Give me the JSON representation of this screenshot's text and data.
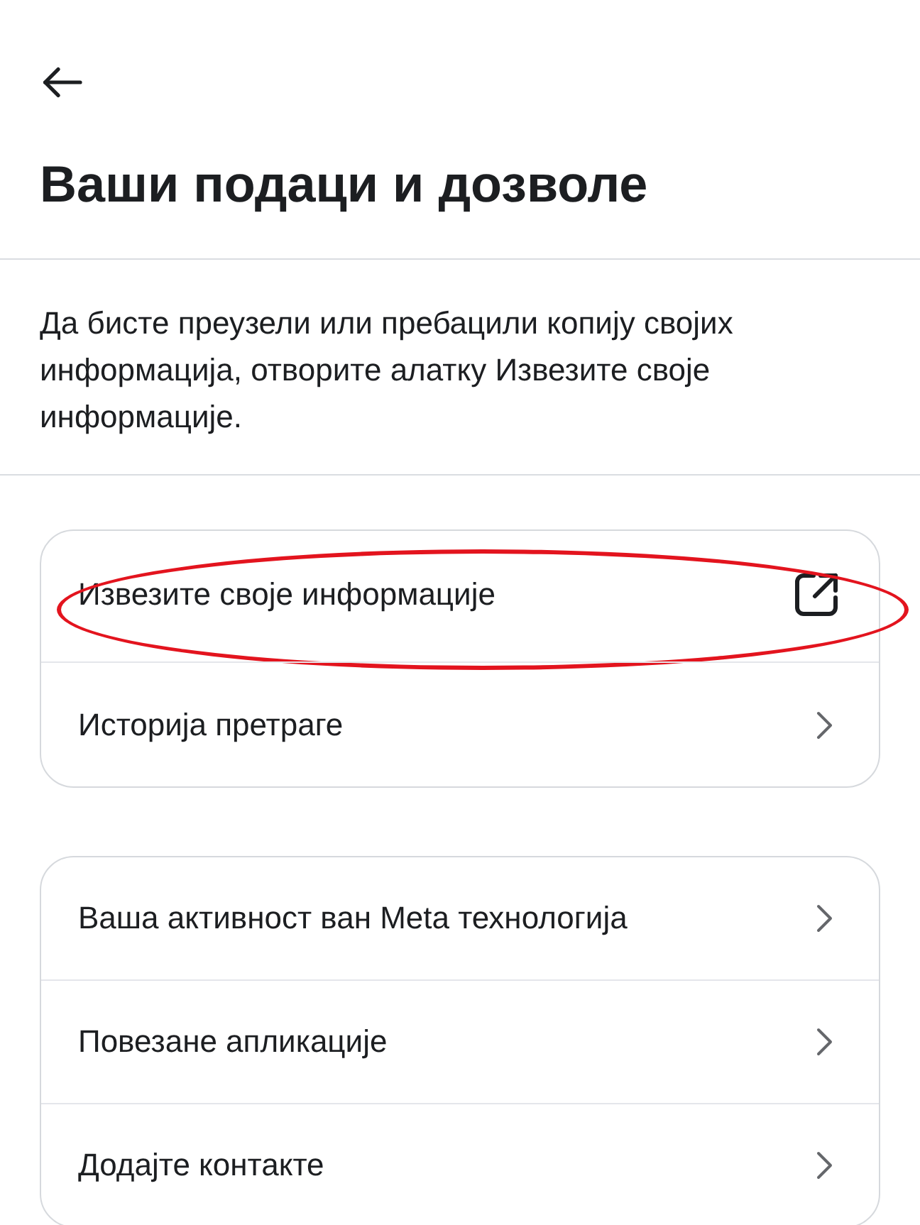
{
  "header": {
    "title": "Ваши подаци и дозволе"
  },
  "description": "Да бисте преузели или пребацили копију својих информација, отворите алатку Извезите своје информације.",
  "groups": [
    {
      "items": [
        {
          "label": "Извезите своје информације",
          "kind": "external",
          "circled": true
        },
        {
          "label": "Историја претраге",
          "kind": "link",
          "circled": false
        }
      ]
    },
    {
      "items": [
        {
          "label": "Ваша активност ван Meta технологија",
          "kind": "link",
          "circled": false
        },
        {
          "label": "Повезане апликације",
          "kind": "link",
          "circled": false
        },
        {
          "label": "Додајте контакте",
          "kind": "link",
          "circled": false
        }
      ]
    }
  ]
}
